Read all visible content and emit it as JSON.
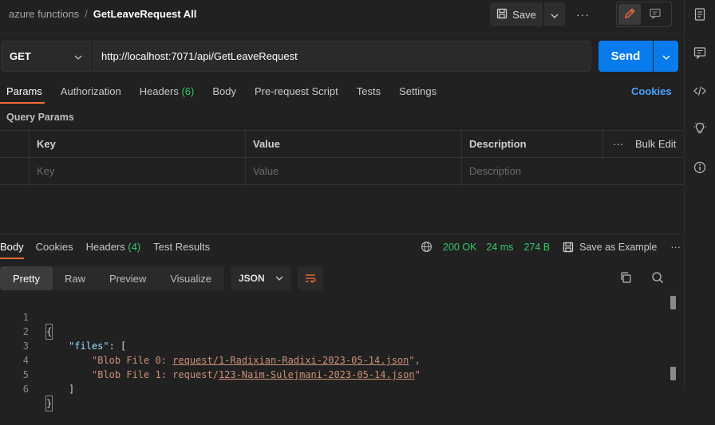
{
  "header": {
    "collection": "azure functions",
    "separator": "/",
    "request_name": "GetLeaveRequest All",
    "save_label": "Save",
    "more": "···"
  },
  "request": {
    "method": "GET",
    "url": "http://localhost:7071/api/GetLeaveRequest",
    "send_label": "Send"
  },
  "request_tabs": {
    "params": "Params",
    "authorization": "Authorization",
    "headers": "Headers",
    "headers_count": "(6)",
    "body": "Body",
    "pre_request": "Pre-request Script",
    "tests": "Tests",
    "settings": "Settings",
    "cookies": "Cookies"
  },
  "query_params": {
    "title": "Query Params",
    "col_key": "Key",
    "col_value": "Value",
    "col_description": "Description",
    "more": "···",
    "bulk_edit": "Bulk Edit",
    "ph_key": "Key",
    "ph_value": "Value",
    "ph_description": "Description"
  },
  "response": {
    "tab_body": "Body",
    "tab_cookies": "Cookies",
    "tab_headers": "Headers",
    "headers_count": "(4)",
    "tab_tests": "Test Results",
    "status": "200 OK",
    "time": "24 ms",
    "size": "274 B",
    "save_example": "Save as Example",
    "more": "···"
  },
  "format": {
    "pretty": "Pretty",
    "raw": "Raw",
    "preview": "Preview",
    "visualize": "Visualize",
    "json": "JSON"
  },
  "code": {
    "n1": "1",
    "n2": "2",
    "n3": "3",
    "n4": "4",
    "n5": "5",
    "n6": "6",
    "open_brace": "{",
    "key_files": "\"files\"",
    "colon_bracket": ": [",
    "item0_a": "\"Blob File 0: ",
    "item0_b": "request/1-Radixian-Radixi-2023-05-14.json",
    "item0_c": "\",",
    "item1_a": "\"Blob File 1: ",
    "item1_b": "request/",
    "item1_c": "123-Naim-Sulejmani-2023-05-14.json",
    "item1_d": "\"",
    "close_bracket": "]",
    "close_brace": "}"
  },
  "colors": {
    "accent_orange": "#ff6c37",
    "send_blue": "#097bed",
    "status_green": "#34c76d",
    "link_blue": "#4aa3ff"
  }
}
